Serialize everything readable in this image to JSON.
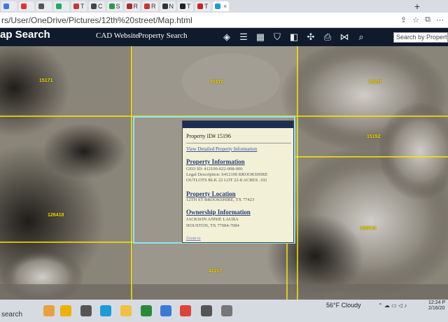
{
  "browser": {
    "tabs": [
      "T",
      "C",
      "S",
      "R",
      "R",
      "N",
      "T",
      "T"
    ],
    "active_tab_close": "×",
    "new_tab": "+",
    "url": "rs/User/OneDrive/Pictures/12th%20street/Map.html"
  },
  "header": {
    "title": "ap Search",
    "nav_cad": "CAD Website",
    "nav_property": "Property Search",
    "search_placeholder": "Search by Property I"
  },
  "map": {
    "parcel_ids": [
      "15171",
      "15170",
      "15187",
      "15192",
      "15196",
      "186218",
      "126418",
      "42217"
    ]
  },
  "popup": {
    "title": "Property ID# 15196",
    "details_link": "View Detailed Property Information",
    "sections": {
      "info_heading": "Property Information",
      "geo_id": "GEO ID: 412100-022-008-000",
      "legal_line1": "Legal Description: S412100 BROOKSHIRE",
      "legal_line2": "OUTLOTS BLK 22 LOT 22-8 ACRES .102",
      "location_heading": "Property Location",
      "location": "12TH ST BROOKSHIRE, TX 77423",
      "owner_heading": "Ownership Information",
      "owner_name": "JACKSON ANNIE LAURA",
      "owner_city": "HOUSTON, TX 77084-7084"
    },
    "zoom_link": "Zoom to"
  },
  "taskbar": {
    "search": "search",
    "weather": "56°F  Cloudy",
    "time": "12:24 P",
    "date": "2/16/20"
  },
  "colors": {
    "header_bg": "#0f1b2d",
    "parcel_line": "#ffe600",
    "selected_parcel": "#8fe3ef",
    "popup_bg": "#f2f0d6"
  }
}
